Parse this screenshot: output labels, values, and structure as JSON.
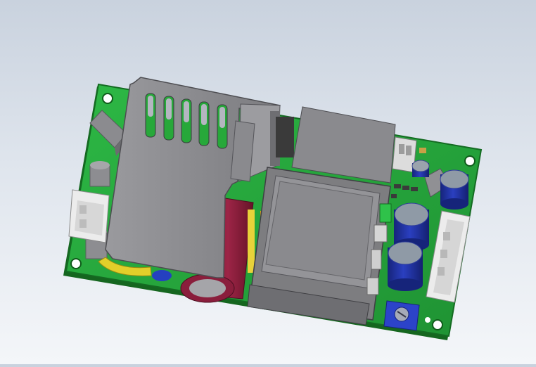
{
  "scene": {
    "subject": "power-supply-pcb-assembly",
    "colors": {
      "background_top": "#c9d2de",
      "background_bottom": "#f4f6f9",
      "pcb": "#27a83a",
      "pcb_dark": "#1a7c29",
      "heatsink": "#8e8e92",
      "transformer": "#7d7d80",
      "capacitor_blue": "#1f2f9a",
      "capacitor_top": "#8f9aa6",
      "bulk_cap": "#8a1e3c",
      "yellow_part": "#e2cf2a",
      "trim_pot": "#2c43c9"
    },
    "icons": [
      "mounting-hole-icon",
      "connector-icon",
      "capacitor-icon",
      "transformer-icon",
      "heatsink-icon",
      "trimmer-potentiometer-icon"
    ]
  }
}
